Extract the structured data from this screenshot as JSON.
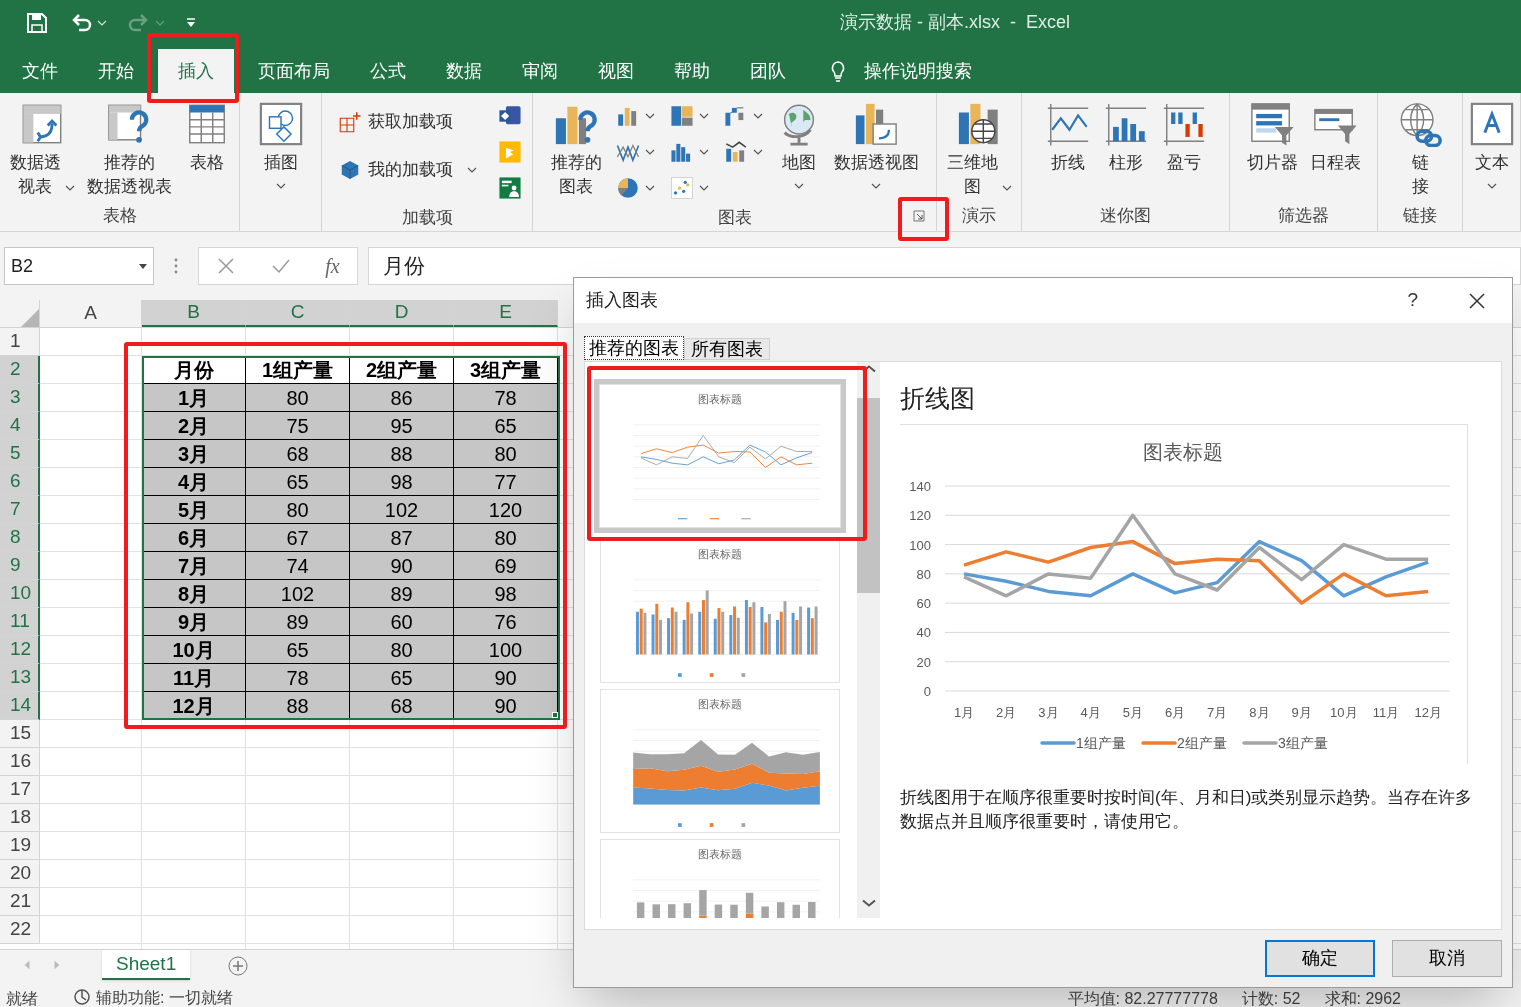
{
  "title_bar": {
    "title": "演示数据 - 副本.xlsx  -  Excel",
    "quick_access": [
      {
        "kind": "save",
        "disabled": false
      },
      {
        "kind": "undo",
        "disabled": false
      },
      {
        "kind": "redo",
        "disabled": true
      },
      {
        "kind": "customize",
        "disabled": false
      }
    ]
  },
  "menu_tabs": [
    {
      "label": "文件",
      "selected": false
    },
    {
      "label": "开始",
      "selected": false
    },
    {
      "label": "插入",
      "selected": true
    },
    {
      "label": "页面布局",
      "selected": false
    },
    {
      "label": "公式",
      "selected": false
    },
    {
      "label": "数据",
      "selected": false
    },
    {
      "label": "审阅",
      "selected": false
    },
    {
      "label": "视图",
      "selected": false
    },
    {
      "label": "帮助",
      "selected": false
    },
    {
      "label": "团队",
      "selected": false
    }
  ],
  "tell_me": "操作说明搜索",
  "ribbon": [
    {
      "label": "表格",
      "items": [
        {
          "kind": "pivot_table",
          "lines": [
            "数据透",
            "视表"
          ]
        },
        {
          "kind": "recommended_pivot",
          "lines": [
            "推荐的",
            "数据透视表"
          ]
        },
        {
          "kind": "table",
          "lines": [
            "表格"
          ]
        }
      ]
    },
    {
      "items": [
        {
          "kind": "illustrations",
          "lines": [
            "插图"
          ]
        }
      ]
    },
    {
      "label": "加载项",
      "items": [
        {
          "kind": "store",
          "lines": [
            "获取加载项"
          ]
        },
        {
          "kind": "addin",
          "lines": [
            "我的加载项"
          ]
        },
        {
          "kind": "visio"
        },
        {
          "kind": "bing"
        },
        {
          "kind": "people"
        }
      ]
    },
    {
      "label": "图表",
      "items": [
        {
          "kind": "recommended_chart",
          "lines": [
            "推荐的",
            "图表"
          ]
        },
        {
          "kind": "column"
        },
        {
          "kind": "line"
        },
        {
          "kind": "pie"
        },
        {
          "kind": "hierarchy"
        },
        {
          "kind": "stat"
        },
        {
          "kind": "scatter"
        },
        {
          "kind": "waterfall"
        },
        {
          "kind": "combo"
        },
        {
          "kind": "globe",
          "lines": [
            "地图"
          ]
        },
        {
          "kind": "pivot_chart",
          "lines": [
            "数据透视图"
          ]
        }
      ]
    },
    {
      "label": "演示",
      "items": [
        {
          "kind": "map3d",
          "lines": [
            "三维地",
            "图"
          ]
        }
      ]
    },
    {
      "label": "迷你图",
      "items": [
        {
          "kind": "spark_line",
          "lines": [
            "折线"
          ]
        },
        {
          "kind": "spark_column",
          "lines": [
            "柱形"
          ]
        },
        {
          "kind": "spark_winloss",
          "lines": [
            "盈亏"
          ]
        }
      ]
    },
    {
      "label": "筛选器",
      "items": [
        {
          "kind": "slicer",
          "lines": [
            "切片器"
          ]
        },
        {
          "kind": "timeline",
          "lines": [
            "日程表"
          ]
        }
      ]
    },
    {
      "label": "链接",
      "items": [
        {
          "kind": "link",
          "lines": [
            "链",
            "接"
          ]
        }
      ]
    },
    {
      "items": [
        {
          "kind": "textbox",
          "lines": [
            "文本"
          ]
        }
      ]
    }
  ],
  "formula_bar": {
    "name_box": "B2",
    "function_button": "fx",
    "value": "月份"
  },
  "sheet": {
    "columns": [
      {
        "label": "A",
        "selected": false
      },
      {
        "label": "B",
        "selected": true
      },
      {
        "label": "C",
        "selected": true
      },
      {
        "label": "D",
        "selected": true
      },
      {
        "label": "E",
        "selected": true
      }
    ],
    "rows": [
      {
        "label": "1",
        "selected": false
      },
      {
        "label": "2",
        "selected": true
      },
      {
        "label": "3",
        "selected": true
      },
      {
        "label": "4",
        "selected": true
      },
      {
        "label": "5",
        "selected": true
      },
      {
        "label": "6",
        "selected": true
      },
      {
        "label": "7",
        "selected": true
      },
      {
        "label": "8",
        "selected": true
      },
      {
        "label": "9",
        "selected": true
      },
      {
        "label": "10",
        "selected": true
      },
      {
        "label": "11",
        "selected": true
      },
      {
        "label": "12",
        "selected": true
      },
      {
        "label": "13",
        "selected": true
      },
      {
        "label": "14",
        "selected": true
      },
      {
        "label": "15",
        "selected": false
      },
      {
        "label": "16",
        "selected": false
      },
      {
        "label": "17",
        "selected": false
      },
      {
        "label": "18",
        "selected": false
      },
      {
        "label": "19",
        "selected": false
      },
      {
        "label": "20",
        "selected": false
      },
      {
        "label": "21",
        "selected": false
      },
      {
        "label": "22",
        "selected": false
      }
    ],
    "table": {
      "header": [
        "月份",
        "1组产量",
        "2组产量",
        "3组产量"
      ],
      "rows": [
        [
          "1月",
          "80",
          "86",
          "78"
        ],
        [
          "2月",
          "75",
          "95",
          "65"
        ],
        [
          "3月",
          "68",
          "88",
          "80"
        ],
        [
          "4月",
          "65",
          "98",
          "77"
        ],
        [
          "5月",
          "80",
          "102",
          "120"
        ],
        [
          "6月",
          "67",
          "87",
          "80"
        ],
        [
          "7月",
          "74",
          "90",
          "69"
        ],
        [
          "8月",
          "102",
          "89",
          "98"
        ],
        [
          "9月",
          "89",
          "60",
          "76"
        ],
        [
          "10月",
          "65",
          "80",
          "100"
        ],
        [
          "11月",
          "78",
          "65",
          "90"
        ],
        [
          "12月",
          "88",
          "68",
          "90"
        ]
      ]
    }
  },
  "sheet_tabs": [
    {
      "label": "Sheet1",
      "selected": true
    }
  ],
  "status_bar": {
    "left": [
      "就绪",
      "辅助功能: 一切就绪"
    ],
    "right": [
      "平均值: 82.27777778",
      "计数: 52",
      "求和: 2962"
    ]
  },
  "dialog": {
    "title": "插入图表",
    "help": "?",
    "tabs": [
      {
        "label": "推荐的图表",
        "selected": true
      },
      {
        "label": "所有图表",
        "selected": false
      }
    ],
    "thumbnails": [
      {
        "kind": "line",
        "title": "图表标题",
        "selected": true
      },
      {
        "kind": "column",
        "title": "图表标题",
        "selected": false
      },
      {
        "kind": "area",
        "title": "图表标题",
        "selected": false
      },
      {
        "kind": "stacked_column",
        "title": "图表标题",
        "selected": false
      }
    ],
    "preview": {
      "heading": "折线图",
      "chart_data": {
        "type": "line",
        "title": "图表标题",
        "categories": [
          "1月",
          "2月",
          "3月",
          "4月",
          "5月",
          "6月",
          "7月",
          "8月",
          "9月",
          "10月",
          "11月",
          "12月"
        ],
        "series": [
          {
            "name": "1组产量",
            "color": "#5b9bd5",
            "values": [
              80,
              75,
              68,
              65,
              80,
              67,
              74,
              102,
              89,
              65,
              78,
              88
            ]
          },
          {
            "name": "2组产量",
            "color": "#ed7d31",
            "values": [
              86,
              95,
              88,
              98,
              102,
              87,
              90,
              89,
              60,
              80,
              65,
              68
            ]
          },
          {
            "name": "3组产量",
            "color": "#a5a5a5",
            "values": [
              78,
              65,
              80,
              77,
              120,
              80,
              69,
              98,
              76,
              100,
              90,
              90
            ]
          }
        ],
        "ylim": [
          0,
          140
        ],
        "yticks": [
          {
            "value": 0,
            "label": "0"
          },
          {
            "value": 20,
            "label": "20"
          },
          {
            "value": 40,
            "label": "40"
          },
          {
            "value": 60,
            "label": "60"
          },
          {
            "value": 80,
            "label": "80"
          },
          {
            "value": 100,
            "label": "100"
          },
          {
            "value": 120,
            "label": "120"
          },
          {
            "value": 140,
            "label": "140"
          }
        ],
        "grid": true,
        "legend": "bottom"
      },
      "description": "折线图用于在顺序很重要时按时间(年、月和日)或类别显示趋势。当存在许多数据点并且顺序很重要时，请使用它。"
    },
    "buttons": [
      {
        "label": "确定",
        "kind": "primary"
      },
      {
        "label": "取消",
        "kind": "normal"
      }
    ]
  }
}
